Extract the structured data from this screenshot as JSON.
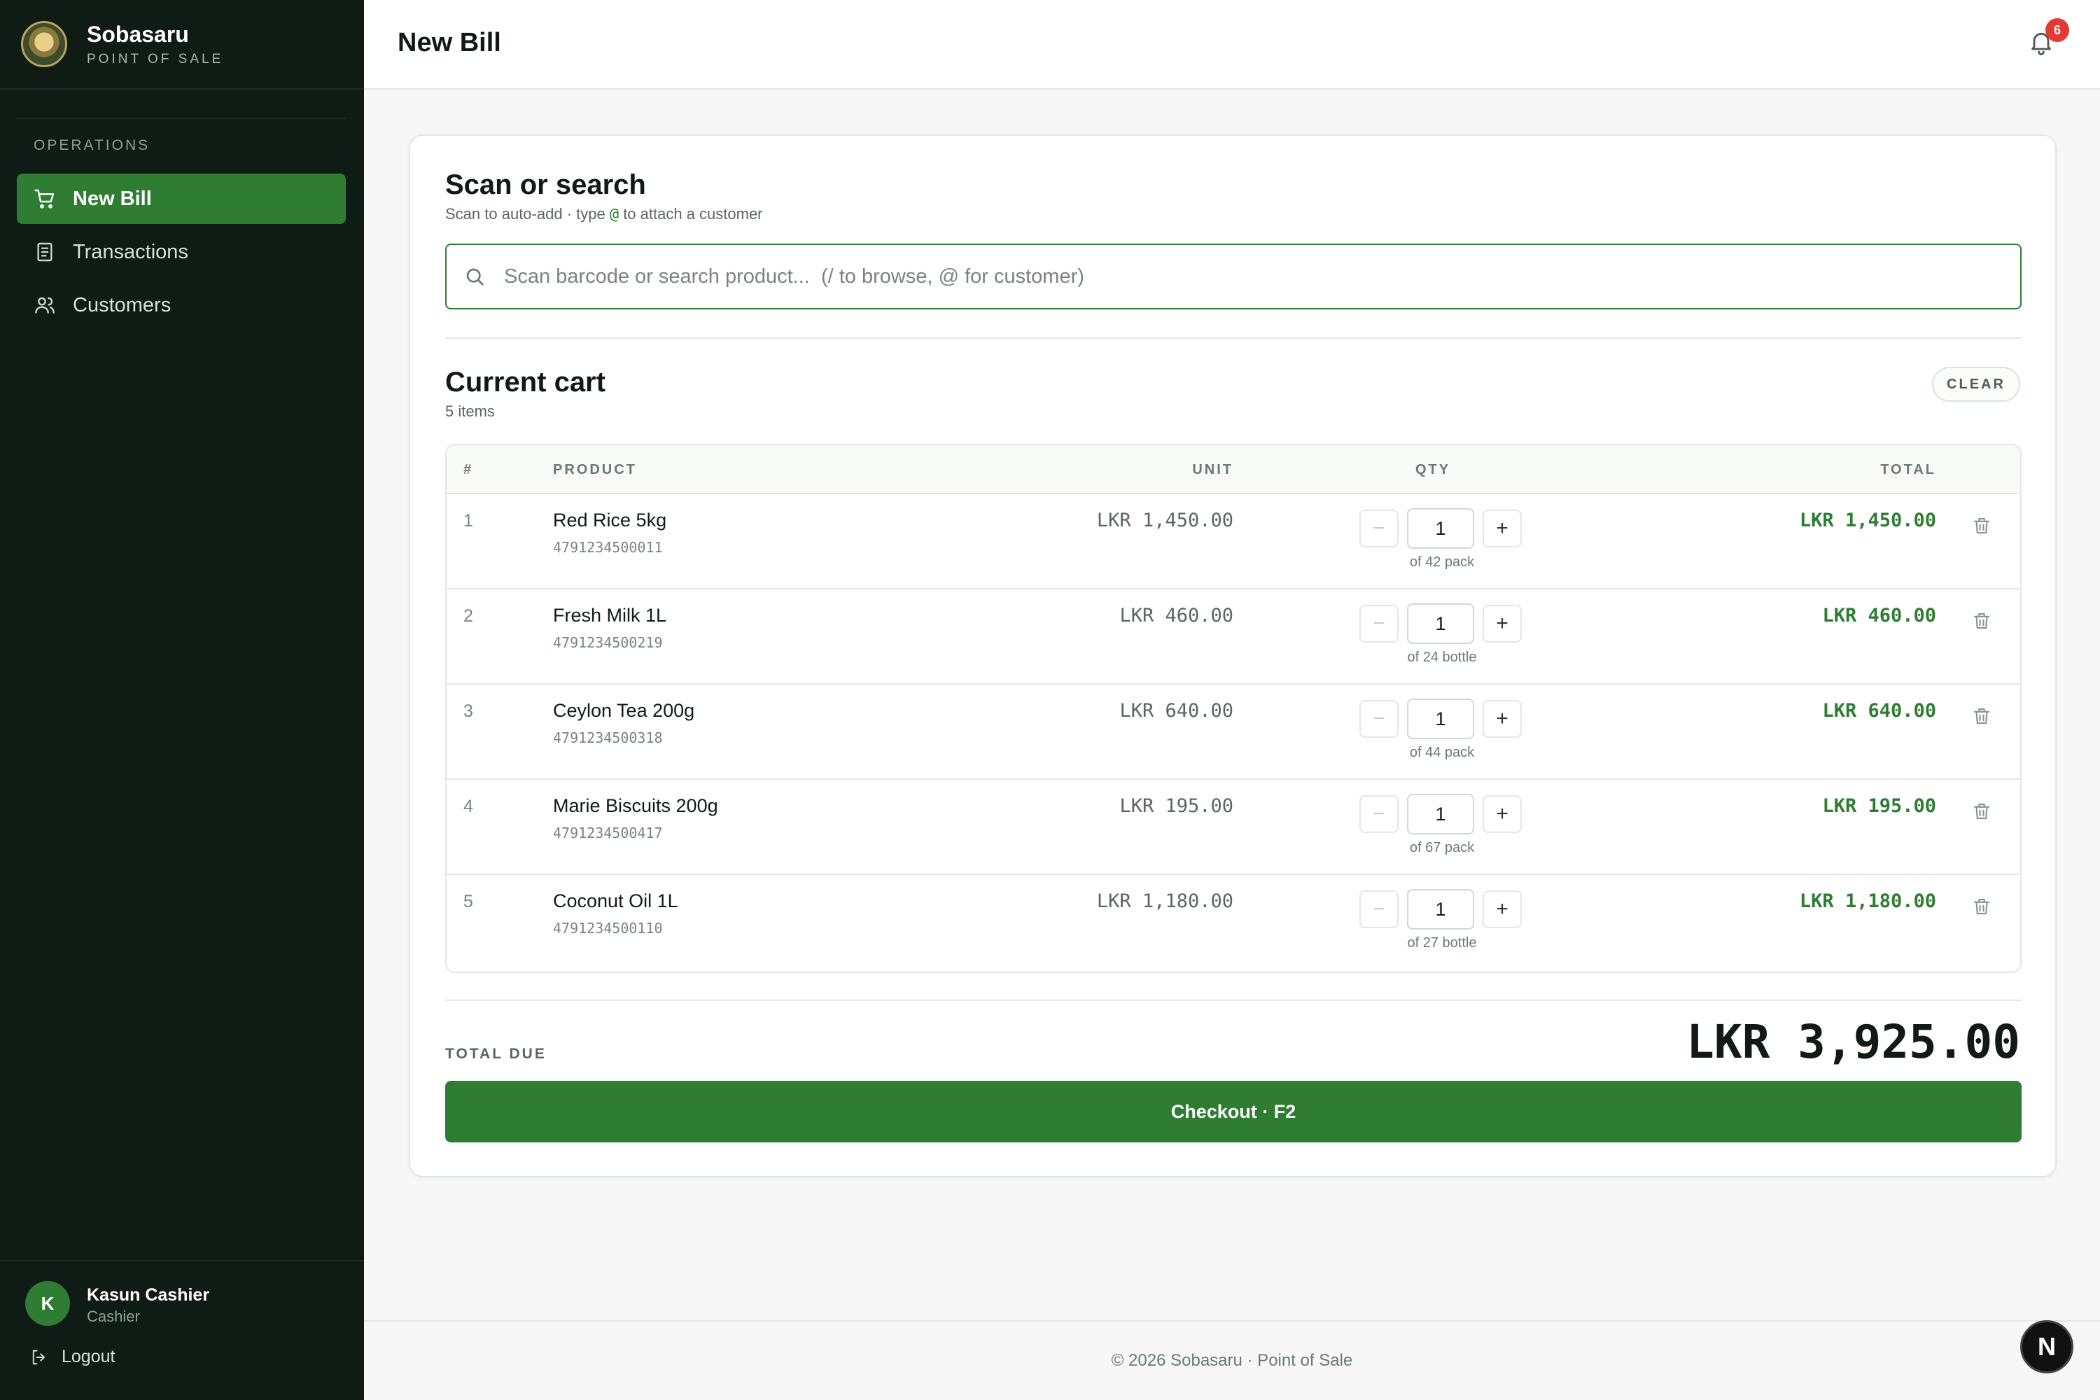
{
  "brand": {
    "name": "Sobasaru",
    "subtitle": "POINT OF SALE",
    "logo_text": "Sobasaru"
  },
  "sidebar": {
    "section_label": "OPERATIONS",
    "items": [
      {
        "label": "New Bill",
        "icon": "cart-icon",
        "active": true
      },
      {
        "label": "Transactions",
        "icon": "receipt-icon",
        "active": false
      },
      {
        "label": "Customers",
        "icon": "users-icon",
        "active": false
      }
    ],
    "user": {
      "initial": "K",
      "name": "Kasun Cashier",
      "role": "Cashier"
    },
    "logout_label": "Logout"
  },
  "header": {
    "title": "New Bill",
    "notifications_count": "6"
  },
  "scan": {
    "title": "Scan or search",
    "subtitle_pre": "Scan to auto-add · type ",
    "subtitle_at": "@",
    "subtitle_post": " to attach a customer",
    "placeholder": "Scan barcode or search product...  (/ to browse, @ for customer)",
    "value": ""
  },
  "cart": {
    "title": "Current cart",
    "count_label": "5 items",
    "clear_label": "CLEAR",
    "columns": {
      "num": "#",
      "product": "PRODUCT",
      "unit": "UNIT",
      "qty": "QTY",
      "total": "TOTAL"
    },
    "rows": [
      {
        "num": "1",
        "name": "Red Rice 5kg",
        "code": "4791234500011",
        "unit": "LKR 1,450.00",
        "qty": "1",
        "stock": "of 42 pack",
        "total": "LKR 1,450.00"
      },
      {
        "num": "2",
        "name": "Fresh Milk 1L",
        "code": "4791234500219",
        "unit": "LKR 460.00",
        "qty": "1",
        "stock": "of 24 bottle",
        "total": "LKR 460.00"
      },
      {
        "num": "3",
        "name": "Ceylon Tea 200g",
        "code": "4791234500318",
        "unit": "LKR 640.00",
        "qty": "1",
        "stock": "of 44 pack",
        "total": "LKR 640.00"
      },
      {
        "num": "4",
        "name": "Marie Biscuits 200g",
        "code": "4791234500417",
        "unit": "LKR 195.00",
        "qty": "1",
        "stock": "of 67 pack",
        "total": "LKR 195.00"
      },
      {
        "num": "5",
        "name": "Coconut Oil 1L",
        "code": "4791234500110",
        "unit": "LKR 1,180.00",
        "qty": "1",
        "stock": "of 27 bottle",
        "total": "LKR 1,180.00"
      }
    ],
    "minus_glyph": "−",
    "plus_glyph": "+"
  },
  "summary": {
    "due_label": "TOTAL DUE",
    "due_value": "LKR 3,925.00",
    "checkout_label": "Checkout · F2"
  },
  "footer": {
    "text": "© 2026 Sobasaru · Point of Sale",
    "dev_badge": "N"
  },
  "colors": {
    "sidebar_bg": "#0f1c15",
    "accent": "#2e7d32",
    "badge": "#e53935"
  }
}
